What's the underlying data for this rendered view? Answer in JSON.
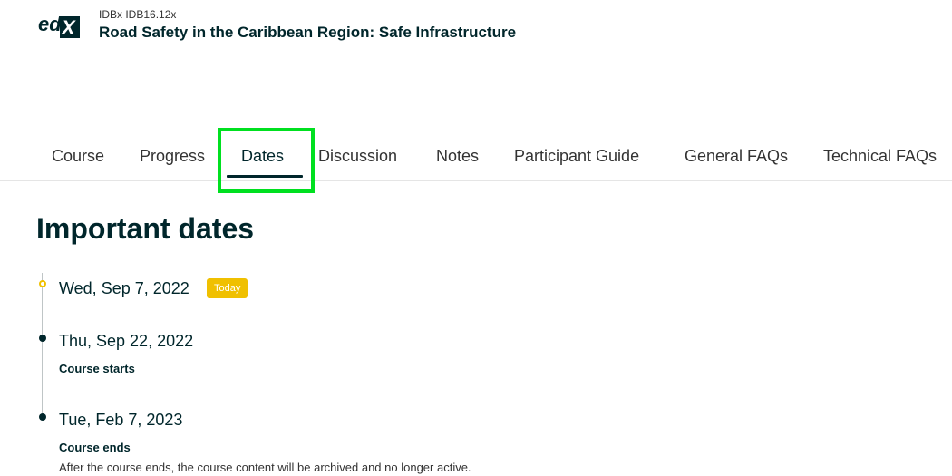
{
  "header": {
    "logo_text": "edX",
    "course_code": "IDBx IDB16.12x",
    "course_title": "Road Safety in the Caribbean Region: Safe Infrastructure"
  },
  "tabs": [
    {
      "label": "Course"
    },
    {
      "label": "Progress"
    },
    {
      "label": "Dates"
    },
    {
      "label": "Discussion"
    },
    {
      "label": "Notes"
    },
    {
      "label": "Participant Guide"
    },
    {
      "label": "General FAQs"
    },
    {
      "label": "Technical FAQs"
    }
  ],
  "active_tab": "Dates",
  "main": {
    "page_title": "Important dates",
    "dates": [
      {
        "date": "Wed, Sep 7, 2022",
        "badge": "Today"
      },
      {
        "date": "Thu, Sep 22, 2022",
        "title": "Course starts"
      },
      {
        "date": "Tue, Feb 7, 2023",
        "title": "Course ends",
        "description": "After the course ends, the course content will be archived and no longer active."
      }
    ]
  },
  "colors": {
    "brand_dark": "#00262b",
    "today_badge": "#f0c000",
    "highlight": "#00e020"
  }
}
